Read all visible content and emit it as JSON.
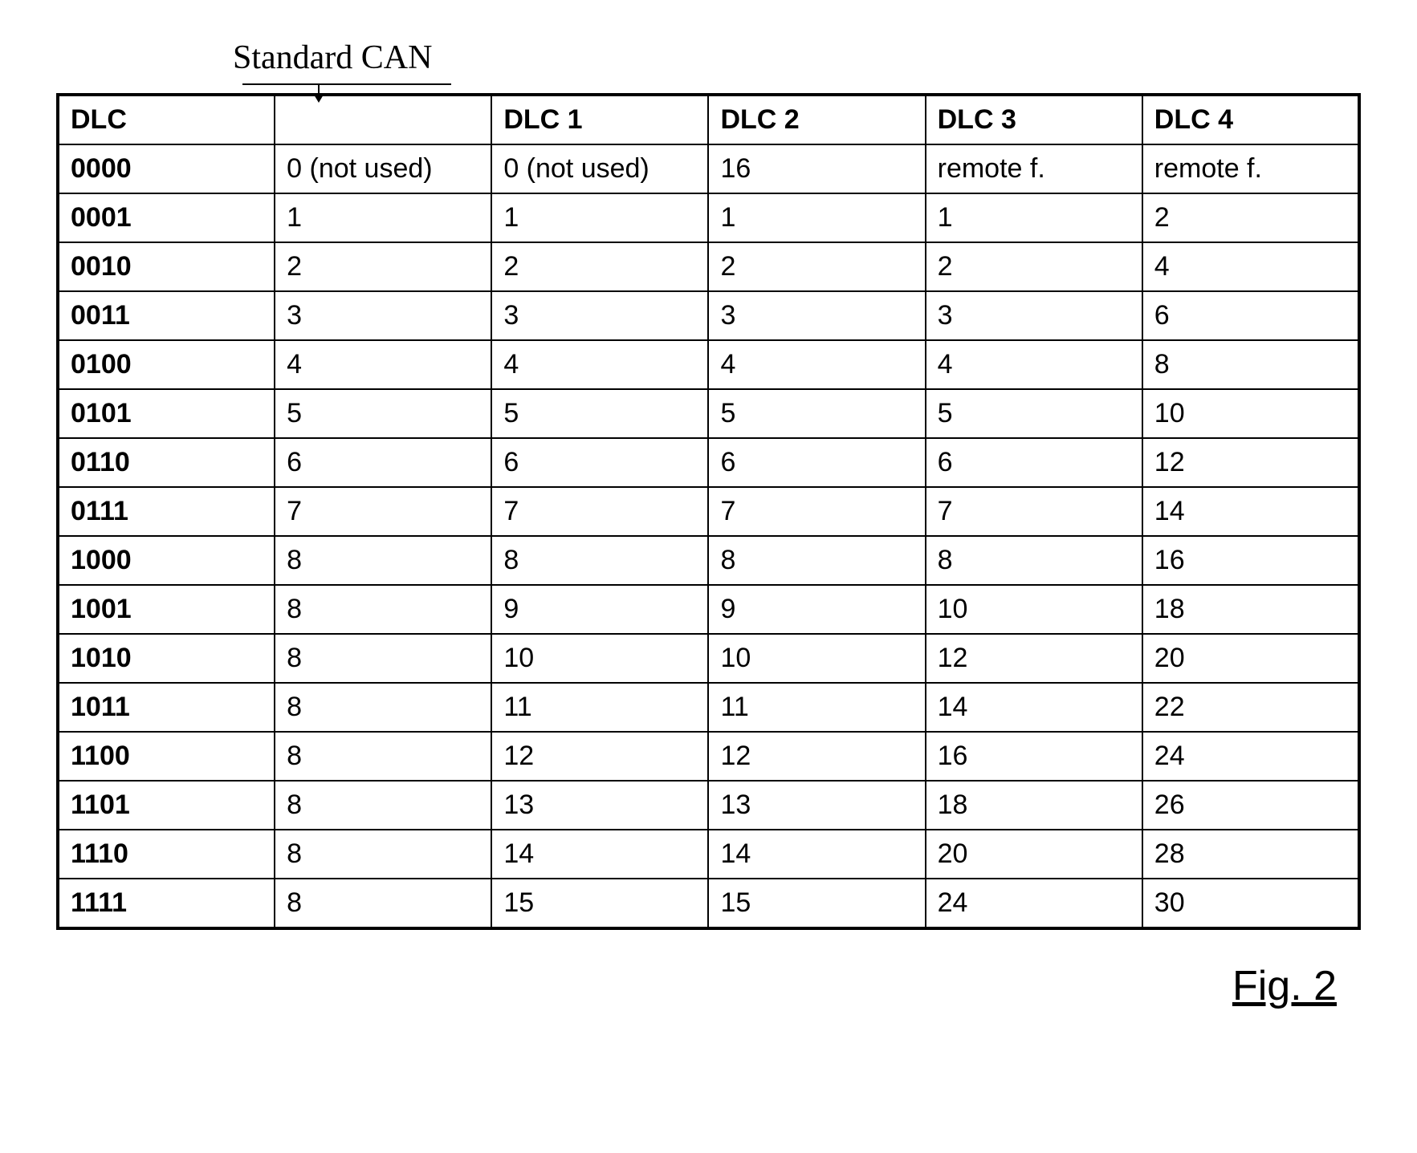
{
  "annotation": "Standard CAN",
  "figure_label": "Fig. 2",
  "chart_data": {
    "type": "table",
    "headers": [
      "DLC",
      "",
      "DLC 1",
      "DLC 2",
      "DLC 3",
      "DLC 4"
    ],
    "rows": [
      [
        "0000",
        "0 (not used)",
        "0 (not used)",
        "16",
        "remote f.",
        "remote f."
      ],
      [
        "0001",
        "1",
        "1",
        "1",
        "1",
        "2"
      ],
      [
        "0010",
        "2",
        "2",
        "2",
        "2",
        "4"
      ],
      [
        "0011",
        "3",
        "3",
        "3",
        "3",
        "6"
      ],
      [
        "0100",
        "4",
        "4",
        "4",
        "4",
        "8"
      ],
      [
        "0101",
        "5",
        "5",
        "5",
        "5",
        "10"
      ],
      [
        "0110",
        "6",
        "6",
        "6",
        "6",
        "12"
      ],
      [
        "0111",
        "7",
        "7",
        "7",
        "7",
        "14"
      ],
      [
        "1000",
        "8",
        "8",
        "8",
        "8",
        "16"
      ],
      [
        "1001",
        "8",
        "9",
        "9",
        "10",
        "18"
      ],
      [
        "1010",
        "8",
        "10",
        "10",
        "12",
        "20"
      ],
      [
        "1011",
        "8",
        "11",
        "11",
        "14",
        "22"
      ],
      [
        "1100",
        "8",
        "12",
        "12",
        "16",
        "24"
      ],
      [
        "1101",
        "8",
        "13",
        "13",
        "18",
        "26"
      ],
      [
        "1110",
        "8",
        "14",
        "14",
        "20",
        "28"
      ],
      [
        "1111",
        "8",
        "15",
        "15",
        "24",
        "30"
      ]
    ]
  }
}
